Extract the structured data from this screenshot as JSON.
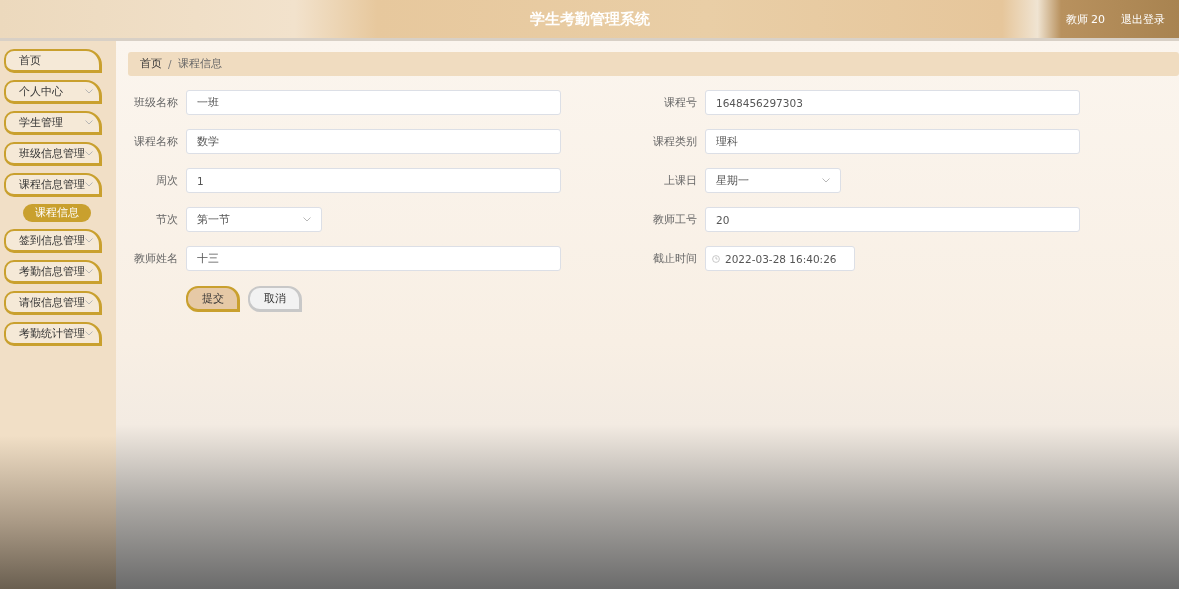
{
  "header": {
    "title": "学生考勤管理系统",
    "user": "教师 20",
    "logout": "退出登录"
  },
  "sidebar": {
    "items": [
      {
        "label": "首页",
        "kind": "link"
      },
      {
        "label": "个人中心",
        "kind": "submenu"
      },
      {
        "label": "学生管理",
        "kind": "submenu"
      },
      {
        "label": "班级信息管理",
        "kind": "submenu"
      },
      {
        "label": "课程信息管理",
        "kind": "submenu",
        "children": [
          {
            "label": "课程信息",
            "selected": true
          }
        ]
      },
      {
        "label": "签到信息管理",
        "kind": "submenu"
      },
      {
        "label": "考勤信息管理",
        "kind": "submenu"
      },
      {
        "label": "请假信息管理",
        "kind": "submenu"
      },
      {
        "label": "考勤统计管理",
        "kind": "submenu"
      }
    ]
  },
  "breadcrumb": [
    "首页",
    "课程信息"
  ],
  "breadcrumb_separator": "/",
  "form": {
    "fields": [
      {
        "label": "班级名称",
        "kind": "text",
        "value": "一班"
      },
      {
        "label": "课程号",
        "kind": "text",
        "value": "1648456297303"
      },
      {
        "label": "课程名称",
        "kind": "text",
        "value": "数学"
      },
      {
        "label": "课程类别",
        "kind": "text",
        "value": "理科"
      },
      {
        "label": "周次",
        "kind": "text",
        "value": "1"
      },
      {
        "label": "上课日",
        "kind": "select",
        "value": "星期一"
      },
      {
        "label": "节次",
        "kind": "select",
        "value": "第一节"
      },
      {
        "label": "教师工号",
        "kind": "text",
        "value": "20"
      },
      {
        "label": "教师姓名",
        "kind": "text",
        "value": "十三"
      },
      {
        "label": "截止时间",
        "kind": "datetime",
        "value": "2022-03-28 16:40:26"
      }
    ],
    "buttons": [
      {
        "label": "提交",
        "kind": "primary"
      },
      {
        "label": "取消",
        "kind": "secondary"
      }
    ]
  }
}
